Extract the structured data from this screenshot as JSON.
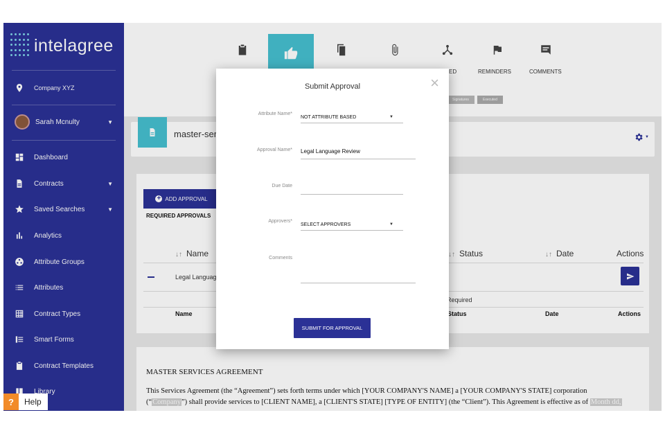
{
  "brand": {
    "name": "intelagree",
    "primary_color": "#2b3196",
    "accent_color": "#46bfd0"
  },
  "sidebar": {
    "company": "Company XYZ",
    "user": "Sarah Mcnulty",
    "items": [
      {
        "label": "Dashboard",
        "icon": "dashboard-icon"
      },
      {
        "label": "Contracts",
        "icon": "document-icon",
        "has_caret": true
      },
      {
        "label": "Saved Searches",
        "icon": "star-icon",
        "has_caret": true
      },
      {
        "label": "Analytics",
        "icon": "bar-chart-icon"
      },
      {
        "label": "Attribute Groups",
        "icon": "group-icon"
      },
      {
        "label": "Attributes",
        "icon": "list-icon"
      },
      {
        "label": "Contract Types",
        "icon": "grid-icon"
      },
      {
        "label": "Smart Forms",
        "icon": "form-icon"
      },
      {
        "label": "Contract Templates",
        "icon": "template-icon"
      },
      {
        "label": "Library",
        "icon": "library-icon"
      }
    ]
  },
  "topnav": {
    "labels": {
      "executed_partial": "ED",
      "reminders": "REMINDERS",
      "comments": "COMMENTS"
    },
    "stages": [
      "Signatures",
      "Executed"
    ]
  },
  "document": {
    "title": "master-servi"
  },
  "approvals": {
    "add_label": "ADD APPROVAL",
    "required_title": "REQUIRED APPROVALS",
    "columns": {
      "name": "Name",
      "status": "Status",
      "date": "Date",
      "actions": "Actions"
    },
    "row": {
      "name": "Legal Languag",
      "status": "Required"
    }
  },
  "contract": {
    "title": "MASTER SERVICES AGREEMENT",
    "line1": "This Services Agreement (the “Agreement”) sets forth terms under which [YOUR COMPANY'S NAME] a [YOUR COMPANY'S STATE] corporation",
    "line2_pre": "(“",
    "line2_company": "Company",
    "line2_mid": "”) shall provide services to [CLIENT NAME], a [CLIENT'S STATE] [TYPE OF ENTITY] (the “Client”). This Agreement is effective as of ",
    "line2_date": "Month dd,"
  },
  "modal": {
    "title": "Submit Approval",
    "close": "×",
    "attribute_name_label": "Attribute Name*",
    "attribute_name_value": "NOT ATTRIBUTE BASED",
    "approval_name_label": "Approval Name*",
    "approval_name_value": "Legal Language Review",
    "due_date_label": "Due Date",
    "due_date_value": "",
    "approvers_label": "Approvers*",
    "approvers_value": "SELECT APPROVERS",
    "comments_label": "Comments",
    "comments_value": "",
    "submit_label": "SUBMIT FOR APPROVAL"
  },
  "help": {
    "label": "Help",
    "icon": "?"
  }
}
